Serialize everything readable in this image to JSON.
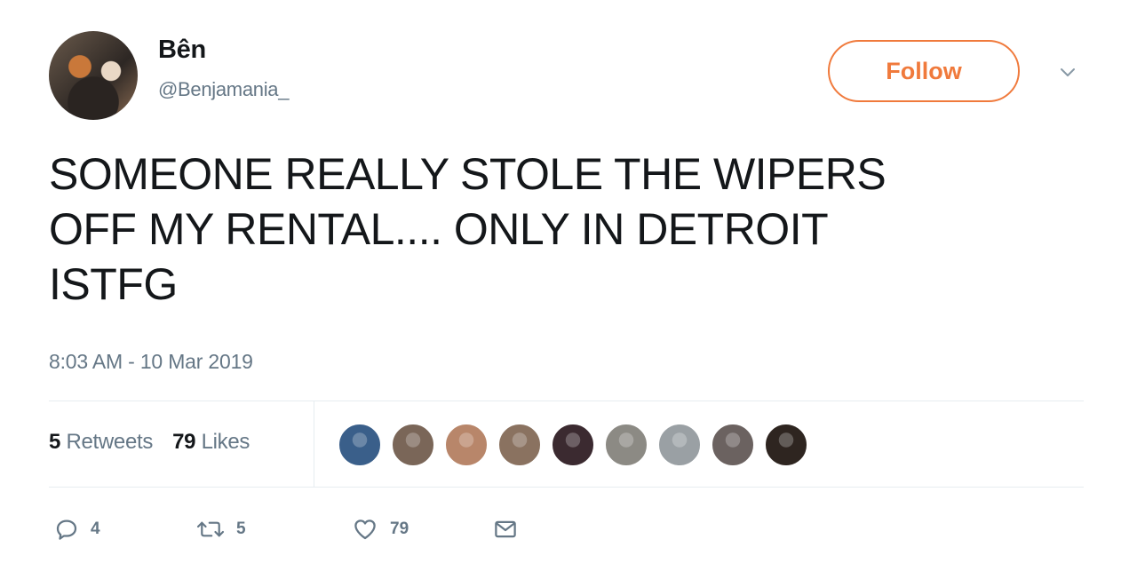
{
  "user": {
    "name": "Bên",
    "handle": "@Benjamania_"
  },
  "follow_label": "Follow",
  "tweet": {
    "line1": "SOMEONE REALLY STOLE THE WIPERS",
    "line2": "OFF MY RENTAL.... ONLY IN DETROIT",
    "line3": "ISTFG",
    "timestamp": "8:03 AM - 10 Mar 2019"
  },
  "stats": {
    "retweets_count": "5",
    "retweets_label": "Retweets",
    "likes_count": "79",
    "likes_label": "Likes"
  },
  "likers": [
    "#3a5f8a",
    "#7a6658",
    "#b8866a",
    "#8a7260",
    "#3b2a30",
    "#8c8a84",
    "#9aa0a4",
    "#6b6260",
    "#2e2520"
  ],
  "actions": {
    "reply_count": "4",
    "retweet_count": "5",
    "like_count": "79"
  },
  "colors": {
    "accent": "#f07a3c",
    "muted": "#657786",
    "text": "#14171a"
  }
}
